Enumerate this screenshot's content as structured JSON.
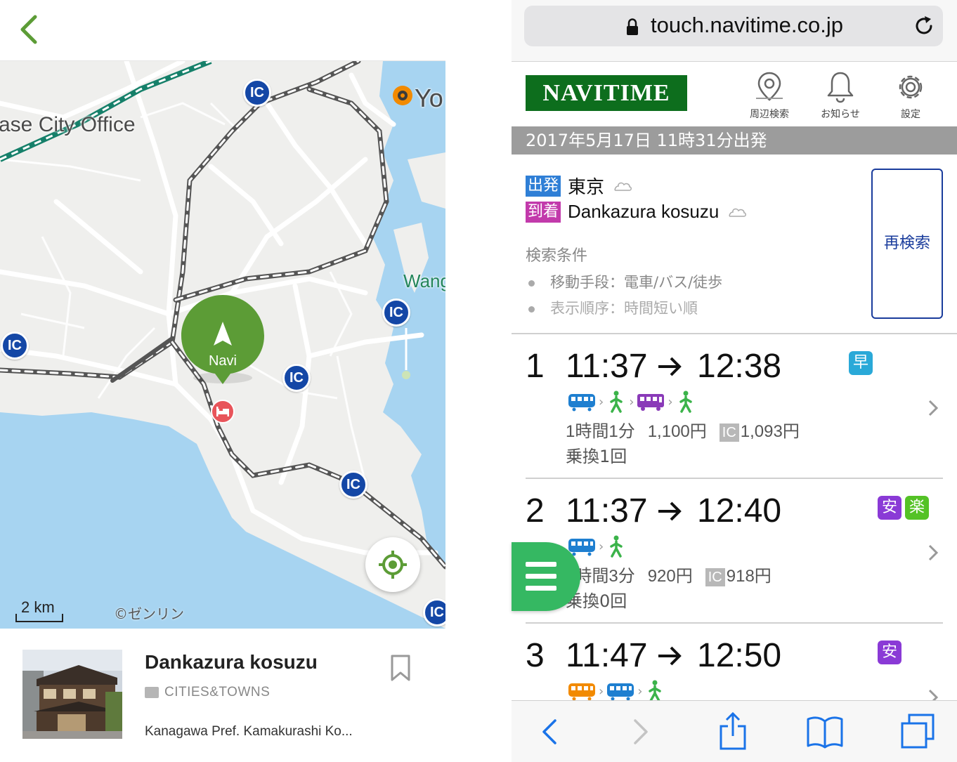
{
  "left_pane": {
    "map": {
      "labels": {
        "city_office": "ase City Office",
        "yo": "Yo",
        "wang": "Wang"
      },
      "ic_markers": [
        "IC",
        "IC",
        "IC",
        "IC",
        "IC",
        "IC"
      ],
      "navi_pin_label": "Navi",
      "scale": "2 km",
      "credit": "©ゼンリン",
      "colors": {
        "water": "#a7d4f1",
        "land": "#efefed",
        "rail_green": "#16806a",
        "pin_green": "#5c9c36",
        "ic_blue": "#1447a6",
        "hotel_red": "#e8545a"
      }
    },
    "place": {
      "name": "Dankazura kosuzu",
      "category": "CITIES&TOWNS",
      "address": "Kanagawa Pref. Kamakurashi Ko..."
    }
  },
  "browser": {
    "url": "touch.navitime.co.jp",
    "header": {
      "logo": "NAVITIME",
      "nearby_label": "周辺検索",
      "notice_label": "お知らせ",
      "settings_label": "設定"
    },
    "date_bar": "2017年5月17日 11時31分出発",
    "search": {
      "dep_tag": "出発",
      "dep_place": "東京",
      "arr_tag": "到着",
      "arr_place": "Dankazura kosuzu",
      "conditions_title": "検索条件",
      "condition1": "移動手段：電車/バス/徒歩",
      "condition2": "表示順序：時間短い順",
      "research_button": "再検索"
    },
    "routes": [
      {
        "num": "1",
        "dep": "11:37",
        "arr": "12:38",
        "badges": [
          "早"
        ],
        "duration": "1時間1分",
        "fare": "1,100円",
        "ic_label": "IC",
        "ic_fare": "1,093円",
        "transfers": "乗換1回"
      },
      {
        "num": "2",
        "dep": "11:37",
        "arr": "12:40",
        "badges": [
          "安",
          "楽"
        ],
        "duration": "1時間3分",
        "fare": "920円",
        "ic_label": "IC",
        "ic_fare": "918円",
        "transfers": "乗換0回"
      },
      {
        "num": "3",
        "dep": "11:47",
        "arr": "12:50",
        "badges": [
          "安"
        ]
      }
    ],
    "colors": {
      "logo_green": "#0d6e1d",
      "date_bar": "#9c9c9c",
      "dep_tag": "#2f7fd6",
      "arr_tag": "#c23aab",
      "badge_fast": "#2aa9d8",
      "badge_cheap": "#8a3ad6",
      "badge_easy": "#54c226",
      "fab_green": "#35b862",
      "link_blue": "#1a3c9c"
    }
  }
}
